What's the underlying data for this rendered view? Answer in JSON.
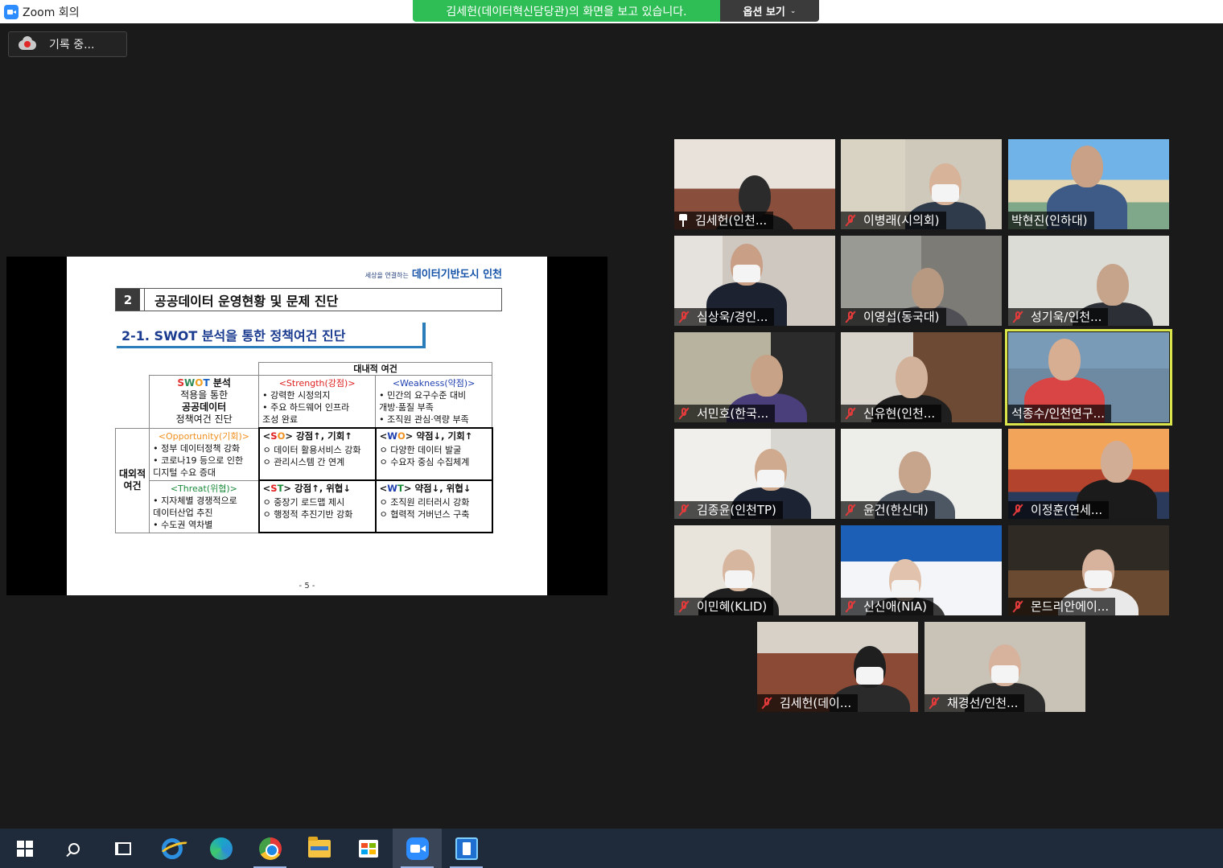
{
  "window": {
    "title": "Zoom 회의"
  },
  "share": {
    "banner": "김세헌(데이터혁신담당관)의 화면을 보고 있습니다.",
    "options_label": "옵션 보기",
    "recording_label": "기록 중..."
  },
  "slide": {
    "logo_small": "세상을 연결하는",
    "logo_main": "데이터기반도시 인천",
    "section_number": "2",
    "section_title": "공공데이터 운영현황 및 문제 진단",
    "subtitle": "2-1. SWOT 분석을 통한 정책여건 진단",
    "internal_header": "대내적 여건",
    "intro": {
      "s": "S",
      "w": "W",
      "o": "O",
      "t": "T",
      "swot_rest": " 분석",
      "line2": "적용을 통한",
      "line3": "공공데이터",
      "line4": "정책여건 진단"
    },
    "strength": {
      "header": "<Strength(강점)>",
      "items": [
        "• 강력한 시정의지",
        "• 주요 하드웨어 인프라",
        "  조성 완료"
      ]
    },
    "weakness": {
      "header": "<Weakness(약점)>",
      "items": [
        "• 민간의 요구수준 대비",
        "  개방·품질 부족",
        "• 조직원 관심·역량 부족"
      ]
    },
    "external_label_1": "대외적",
    "external_label_2": "여건",
    "opportunity": {
      "header": "<Opportunity(기회)>",
      "items": [
        "• 정부 데이터정책 강화",
        "• 코로나19 등으로 인한",
        "  디지털 수요 증대"
      ]
    },
    "threat": {
      "header": "<Threat(위협)>",
      "items": [
        "• 지자체별 경쟁적으로",
        "  데이터산업 추진",
        "• 수도권 역차별"
      ]
    },
    "so": {
      "lt": "<",
      "a": "S",
      "b": "O",
      "rest": "> 강점↑, 기회↑",
      "items": [
        "ㅇ 데이터 활용서비스 강화",
        "ㅇ 관리시스템 간 연계"
      ]
    },
    "wo": {
      "lt": "<",
      "a": "W",
      "b": "O",
      "rest": "> 약점↓, 기회↑",
      "items": [
        "ㅇ 다양한 데이터 발굴",
        "ㅇ 수요자 중심 수집체계"
      ]
    },
    "st": {
      "lt": "<",
      "a": "S",
      "b": "T",
      "rest": "> 강점↑, 위협↓",
      "items": [
        "ㅇ 중장기 로드맵 제시",
        "ㅇ 행정적 추진기반 강화"
      ]
    },
    "wt": {
      "lt": "<",
      "a": "W",
      "b": "T",
      "rest": "> 약점↓, 위협↓",
      "items": [
        "ㅇ 조직원 리터러시 강화",
        "ㅇ 협력적 거버넌스 구축"
      ]
    },
    "page": "- 5 -"
  },
  "participants": [
    {
      "name": "김세헌(인천...",
      "icon": "pin-icon",
      "active": false
    },
    {
      "name": "이병래(시의회)",
      "icon": "mic-off-icon",
      "active": false
    },
    {
      "name": "박현진(인하대)",
      "icon": "",
      "active": false
    },
    {
      "name": "심상욱/경인...",
      "icon": "mic-off-icon",
      "active": false
    },
    {
      "name": "이영섭(동국대)",
      "icon": "mic-off-icon",
      "active": false
    },
    {
      "name": "성기욱/인천...",
      "icon": "mic-off-icon",
      "active": false
    },
    {
      "name": "서민호(한국...",
      "icon": "mic-off-icon",
      "active": false
    },
    {
      "name": "신유현(인천...",
      "icon": "mic-off-icon",
      "active": false
    },
    {
      "name": "석종수/인천연구...",
      "icon": "",
      "active": true
    },
    {
      "name": "김종윤(인천TP)",
      "icon": "mic-off-icon",
      "active": false
    },
    {
      "name": "윤건(한신대)",
      "icon": "mic-off-icon",
      "active": false
    },
    {
      "name": "이정훈(연세...",
      "icon": "mic-off-icon",
      "active": false
    },
    {
      "name": "이민혜(KLID)",
      "icon": "mic-off-icon",
      "active": false
    },
    {
      "name": "신신애(NIA)",
      "icon": "mic-off-icon",
      "active": false
    },
    {
      "name": "몬드리안에이...",
      "icon": "mic-off-icon",
      "active": false
    },
    {
      "name": "김세헌(데이...",
      "icon": "mic-off-icon",
      "active": false
    },
    {
      "name": "채경선/인천...",
      "icon": "mic-off-icon",
      "active": false
    }
  ],
  "taskbar": {
    "items": [
      "start-button",
      "search-icon",
      "task-view-icon",
      "internet-explorer-icon",
      "edge-icon",
      "chrome-icon",
      "file-explorer-icon",
      "store-icon",
      "zoom-icon",
      "app-icon"
    ]
  }
}
